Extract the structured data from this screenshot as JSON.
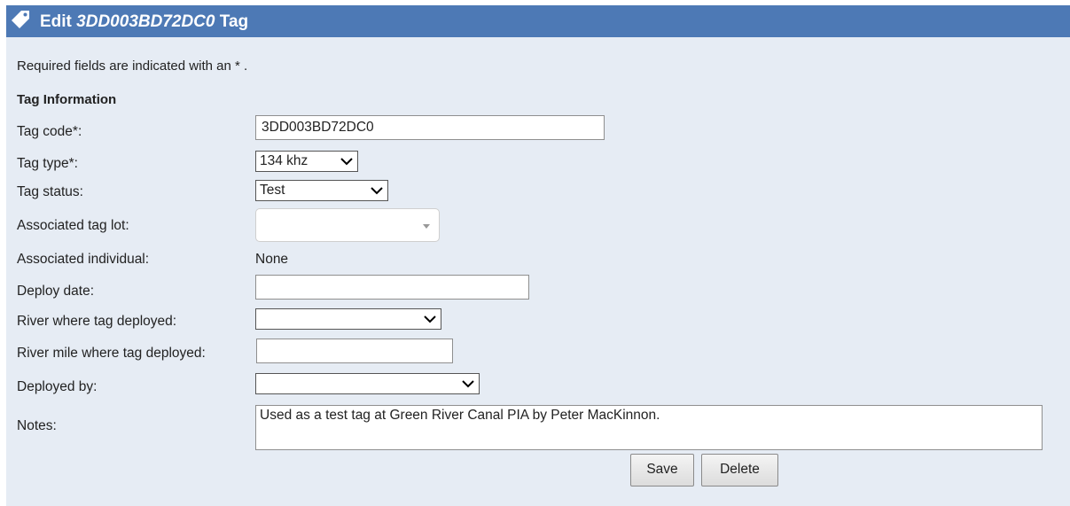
{
  "header": {
    "title_prefix": "Edit ",
    "tag_code": "3DD003BD72DC0",
    "title_suffix": " Tag",
    "icon": "tag-icon"
  },
  "required_note": "Required fields are indicated with an * .",
  "section_title": "Tag Information",
  "fields": {
    "tag_code": {
      "label": "Tag code*:",
      "value": "3DD003BD72DC0"
    },
    "tag_type": {
      "label": "Tag type*:",
      "value": "134 khz"
    },
    "tag_status": {
      "label": "Tag status:",
      "value": "Test"
    },
    "tag_lot": {
      "label": "Associated tag lot:",
      "value": ""
    },
    "individual": {
      "label": "Associated individual:",
      "value": "None"
    },
    "deploy_date": {
      "label": "Deploy date:",
      "value": ""
    },
    "river": {
      "label": "River where tag deployed:",
      "value": ""
    },
    "river_mile": {
      "label": "River mile where tag deployed:",
      "value": ""
    },
    "deployed_by": {
      "label": "Deployed by:",
      "value": ""
    },
    "notes": {
      "label": "Notes:",
      "value": "Used as a test tag at Green River Canal PIA by Peter MacKinnon."
    }
  },
  "buttons": {
    "save": "Save",
    "delete": "Delete"
  },
  "colors": {
    "header_bg": "#4d79b5",
    "panel_bg": "#e6ecf4"
  }
}
